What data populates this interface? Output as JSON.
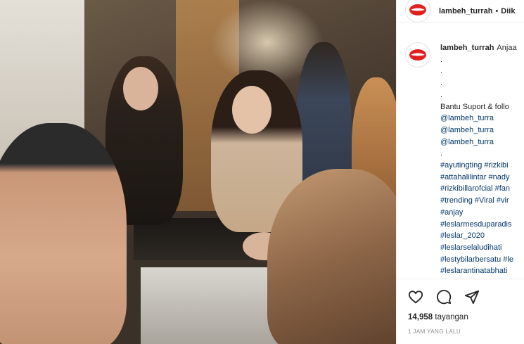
{
  "post": {
    "username": "lambeh_turrah",
    "separator": "•",
    "follow_label": "Diik"
  },
  "caption": {
    "username": "lambeh_turrah",
    "first_text": "Anjaa",
    "lines": [
      ".",
      ".",
      ".",
      ".",
      "Bantu Suport & follo",
      "@lambeh_turra",
      "@lambeh_turra",
      "@lambeh_turra",
      ".",
      "#ayutingting #rizkibi",
      "#attahalilintar #nady",
      "#rizkibillarofcial #fan",
      "#trending #Viral #vir",
      "#anjay",
      "#leslarmesduparadis",
      "#leslar_2020",
      "#leslarselaludihati",
      "#lestybilarbersatu #le",
      "#leslarantinatabhati"
    ]
  },
  "actions": {
    "like_icon": "heart-icon",
    "comment_icon": "comment-icon",
    "share_icon": "paper-plane-icon"
  },
  "stats": {
    "views_count": "14,958",
    "views_label": "tayangan",
    "timestamp": "1 JAM YANG LALU"
  },
  "colors": {
    "avatar_lips": "#e0201e",
    "link": "#00376b",
    "muted": "#8e8e8e"
  }
}
